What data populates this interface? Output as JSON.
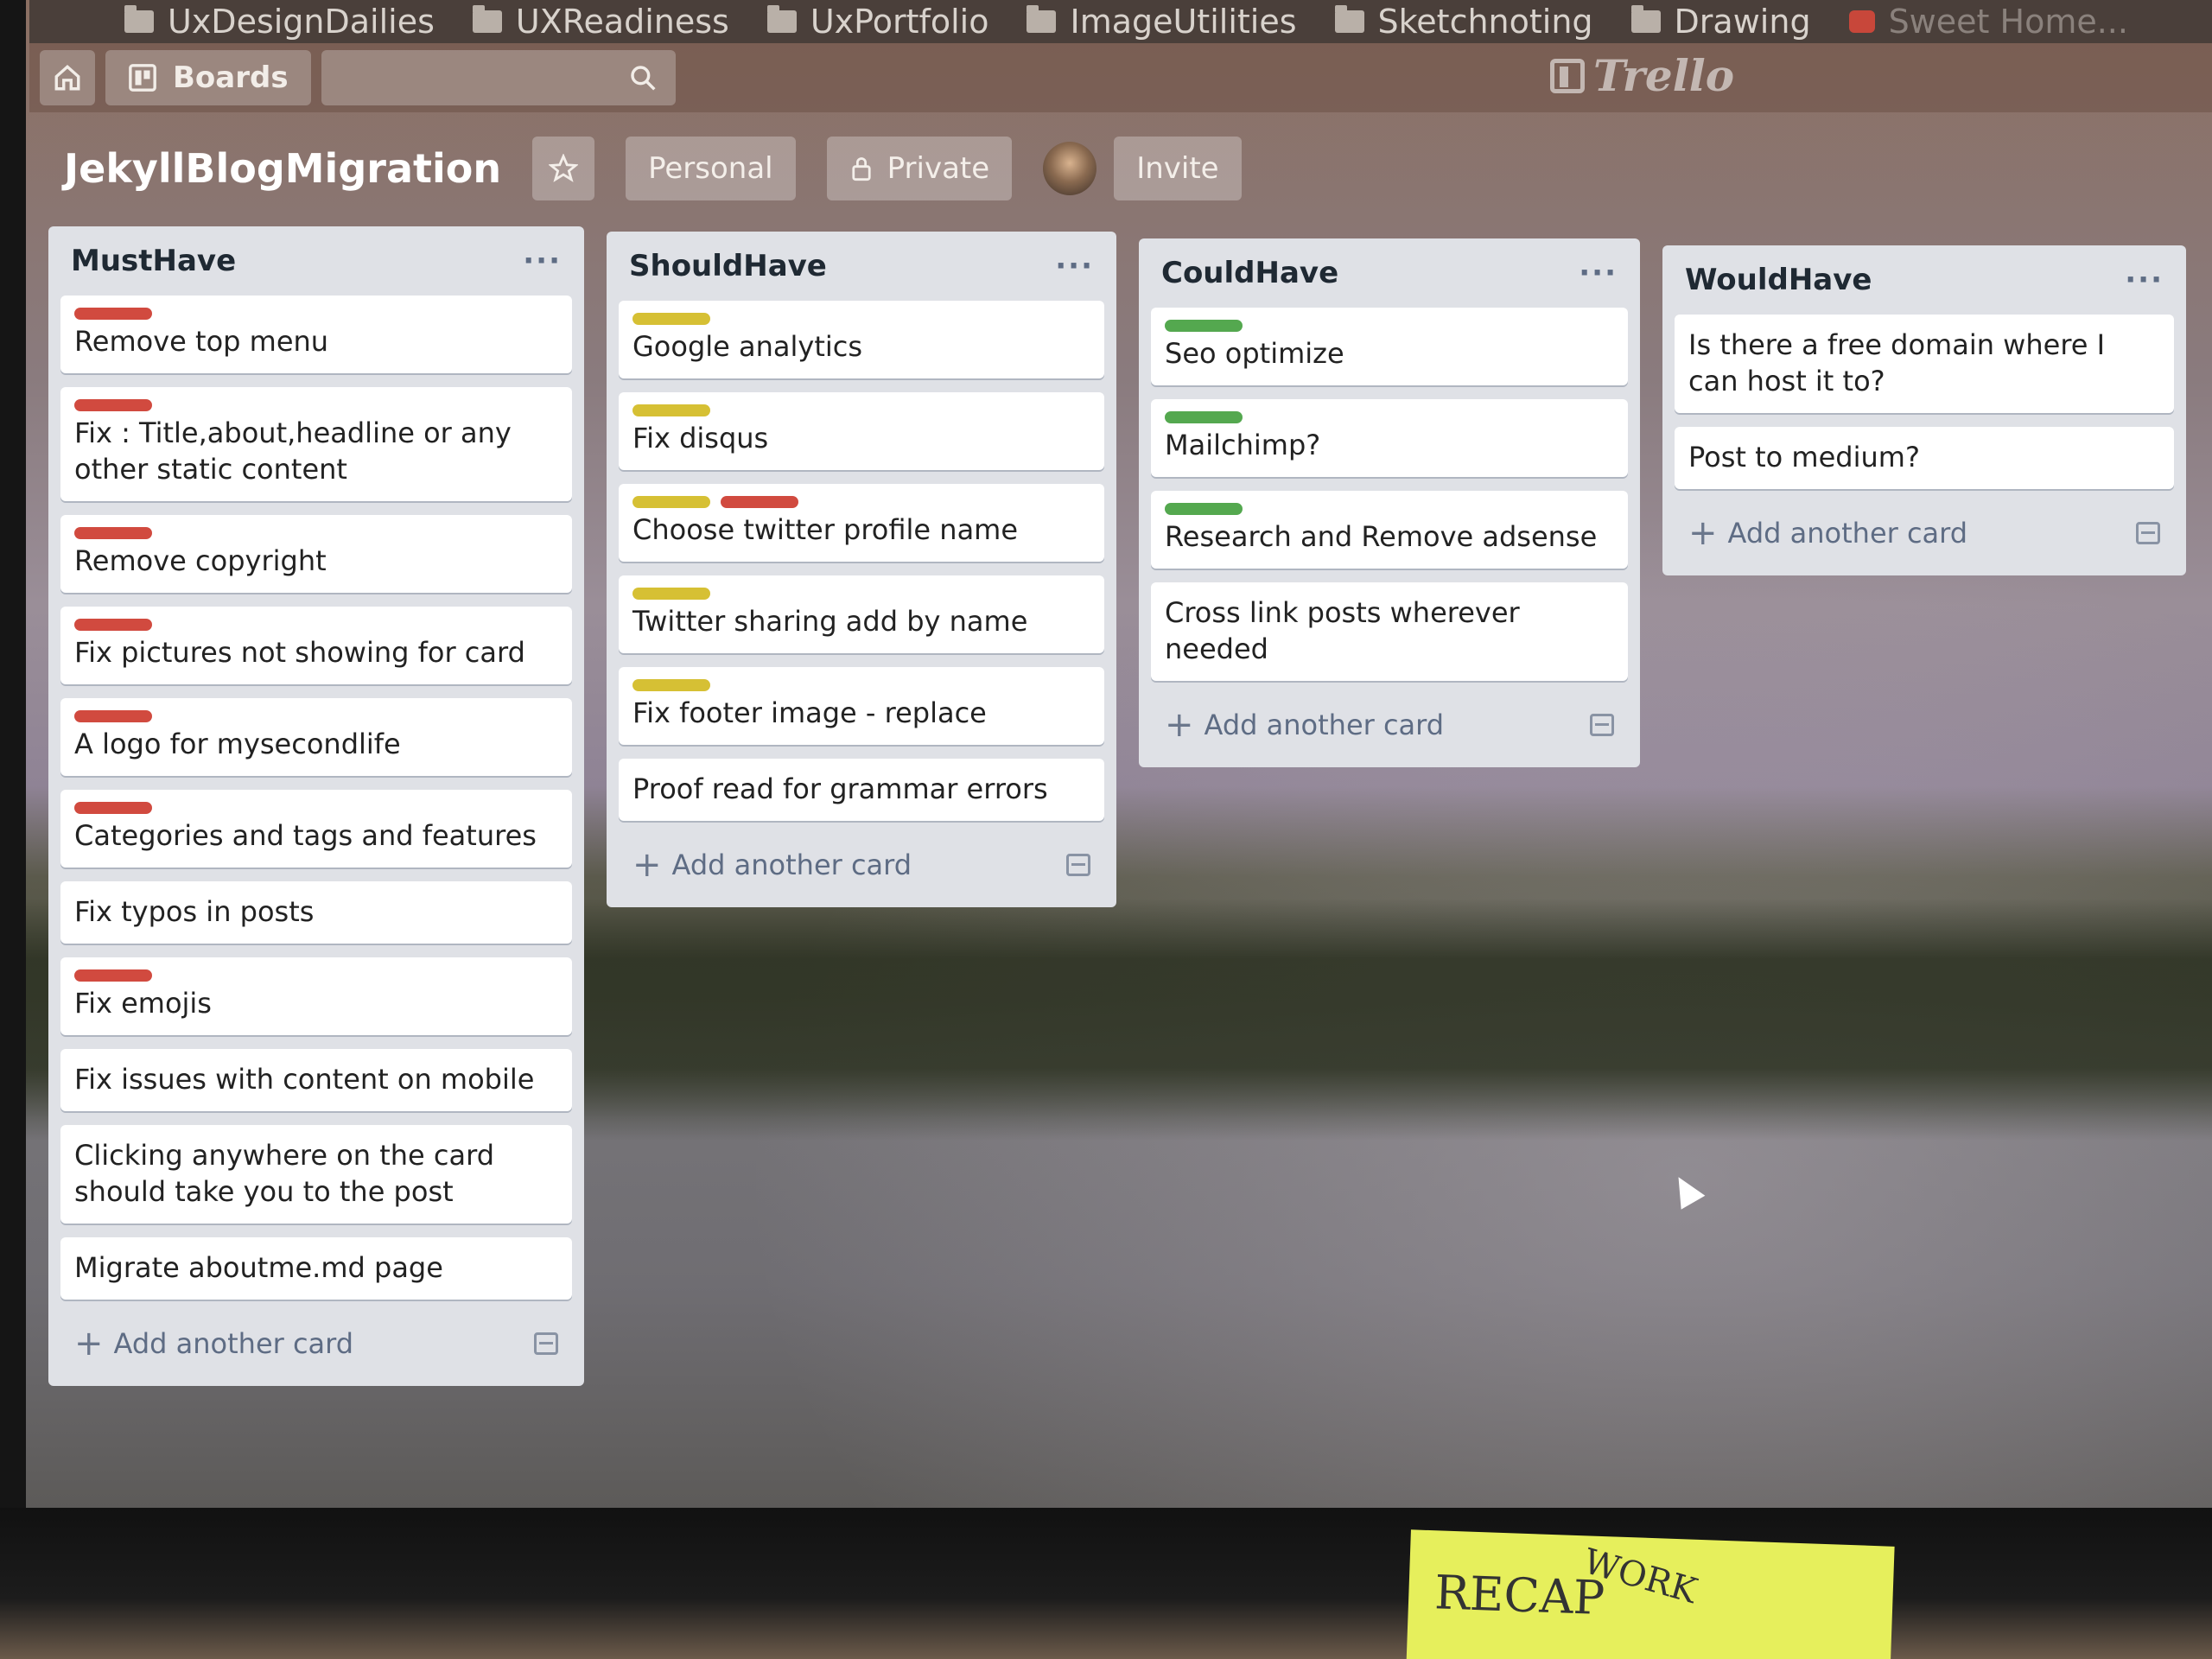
{
  "bookmarks": [
    {
      "label": "UxDesignDailies",
      "icon": "folder-icon"
    },
    {
      "label": "UXReadiness",
      "icon": "folder-icon"
    },
    {
      "label": "UxPortfolio",
      "icon": "folder-icon"
    },
    {
      "label": "ImageUtilities",
      "icon": "folder-icon"
    },
    {
      "label": "Sketchnoting",
      "icon": "folder-icon"
    },
    {
      "label": "Drawing",
      "icon": "folder-icon"
    },
    {
      "label": "Sweet Home...",
      "icon": "red-bookmark-icon"
    }
  ],
  "header": {
    "boards_label": "Boards",
    "search_placeholder": "",
    "logo_text": "Trello"
  },
  "board": {
    "title": "JekyllBlogMigration",
    "team_label": "Personal",
    "visibility_label": "Private",
    "invite_label": "Invite"
  },
  "colors": {
    "red": "#d14a3f",
    "yellow": "#d6c034",
    "green": "#54a84f"
  },
  "lists": [
    {
      "title": "MustHave",
      "menu": "···",
      "add_label": "Add another card",
      "cards": [
        {
          "text": "Remove top menu",
          "labels": [
            "red"
          ]
        },
        {
          "text": "Fix : Title,about,headline or any other static content",
          "labels": [
            "red"
          ]
        },
        {
          "text": "Remove copyright",
          "labels": [
            "red"
          ]
        },
        {
          "text": "Fix pictures not showing for card",
          "labels": [
            "red"
          ]
        },
        {
          "text": "A logo for mysecondlife",
          "labels": [
            "red"
          ]
        },
        {
          "text": "Categories and tags and features",
          "labels": [
            "red"
          ]
        },
        {
          "text": "Fix typos in posts",
          "labels": []
        },
        {
          "text": "Fix emojis",
          "labels": [
            "red"
          ]
        },
        {
          "text": "Fix issues with content on mobile",
          "labels": []
        },
        {
          "text": "Clicking anywhere on the card should take you to the post",
          "labels": []
        },
        {
          "text": "Migrate aboutme.md page",
          "labels": []
        }
      ]
    },
    {
      "title": "ShouldHave",
      "menu": "···",
      "add_label": "Add another card",
      "cards": [
        {
          "text": "Google analytics",
          "labels": [
            "yellow"
          ]
        },
        {
          "text": "Fix disqus",
          "labels": [
            "yellow"
          ]
        },
        {
          "text": "Choose twitter profile name",
          "labels": [
            "yellow",
            "red"
          ]
        },
        {
          "text": "Twitter sharing add by name",
          "labels": [
            "yellow"
          ]
        },
        {
          "text": "Fix footer image - replace",
          "labels": [
            "yellow"
          ]
        },
        {
          "text": "Proof read for grammar errors",
          "labels": []
        }
      ]
    },
    {
      "title": "CouldHave",
      "menu": "···",
      "add_label": "Add another card",
      "cards": [
        {
          "text": "Seo optimize",
          "labels": [
            "green"
          ]
        },
        {
          "text": "Mailchimp?",
          "labels": [
            "green"
          ]
        },
        {
          "text": "Research and Remove adsense",
          "labels": [
            "green"
          ]
        },
        {
          "text": "Cross link posts wherever needed",
          "labels": []
        }
      ]
    },
    {
      "title": "WouldHave",
      "menu": "···",
      "add_label": "Add another card",
      "cards": [
        {
          "text": "Is there a free domain where I can host it to?",
          "labels": []
        },
        {
          "text": "Post to medium?",
          "labels": []
        }
      ]
    }
  ],
  "sticky_note": {
    "line1": "RECAP",
    "line2": "WORK"
  }
}
